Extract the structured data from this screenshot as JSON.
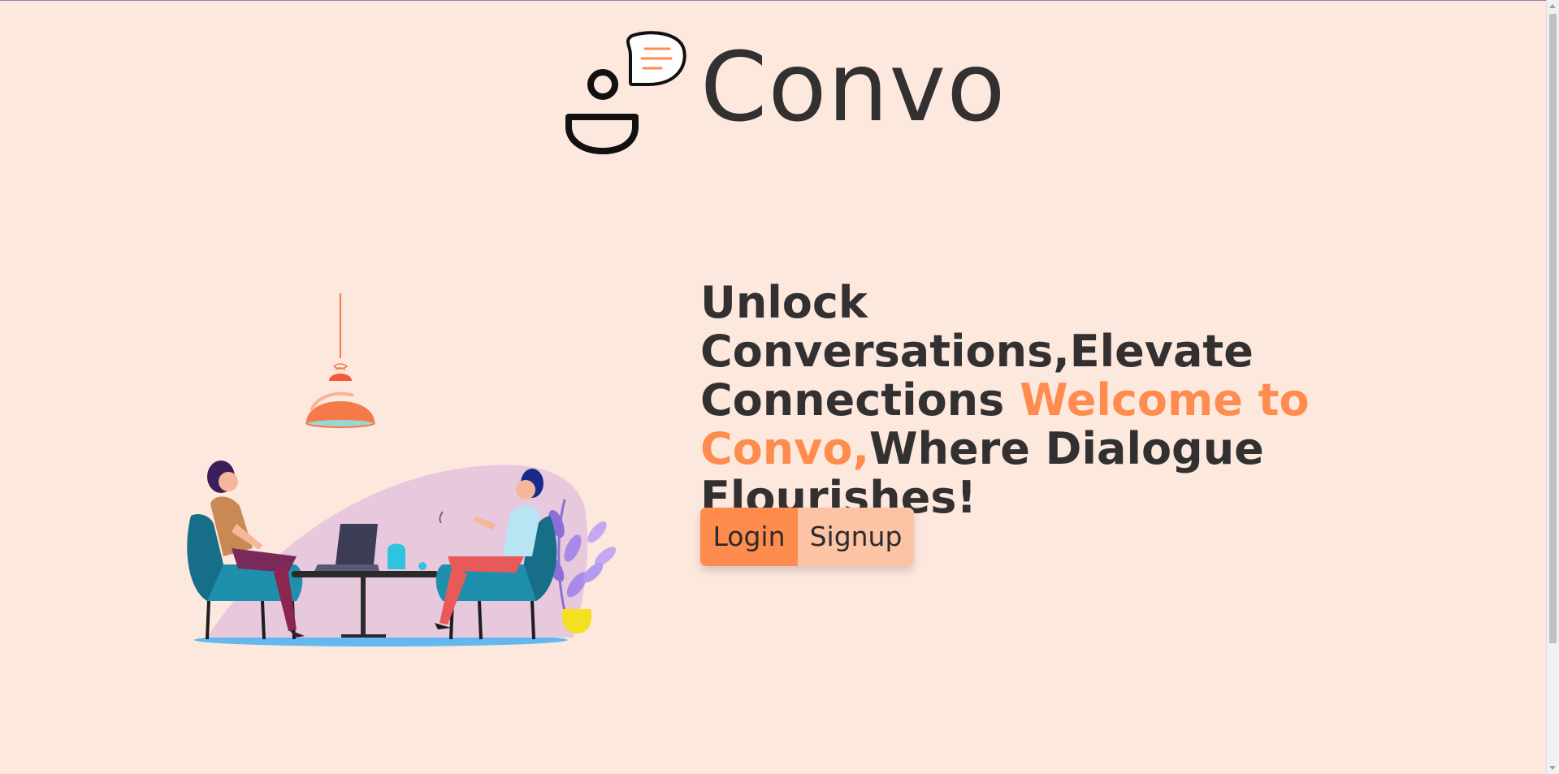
{
  "brand": {
    "name": "Convo",
    "logo_icon": "user-chat-icon"
  },
  "hero": {
    "title_part1": "Unlock Conversations,Elevate Connections ",
    "title_accent": "Welcome to Convo,",
    "title_part2": "Where Dialogue Flourishes!"
  },
  "buttons": {
    "login_label": "Login",
    "signup_label": "Signup"
  },
  "colors": {
    "background": "#fde8de",
    "accent": "#fd8c4e",
    "accent_light": "#fcc3a5",
    "text": "#333031"
  },
  "illustration": {
    "icon": "two-people-conversation-illustration"
  }
}
